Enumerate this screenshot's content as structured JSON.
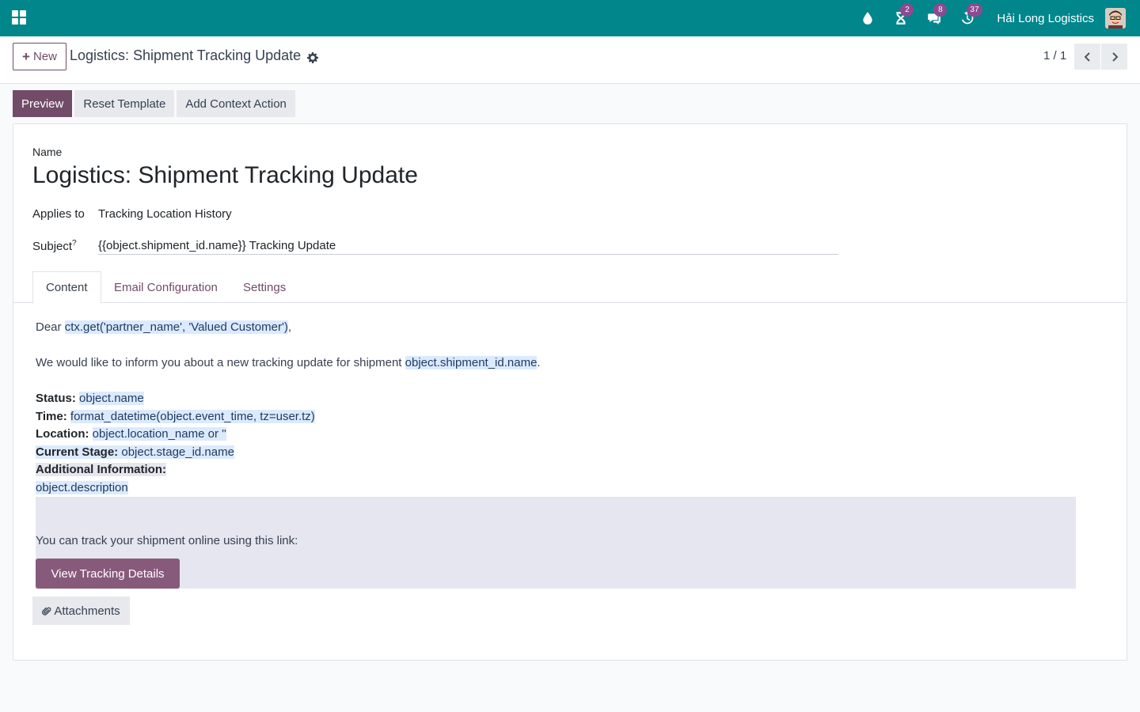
{
  "navbar": {
    "company": "Hải Long Logistics",
    "badges": {
      "activities": "2",
      "messages": "8",
      "updates": "37"
    }
  },
  "control_panel": {
    "new_label": "New",
    "title": "Logistics: Shipment Tracking Update",
    "pager": "1 / 1"
  },
  "header_buttons": {
    "preview": "Preview",
    "reset": "Reset Template",
    "context": "Add Context Action"
  },
  "form": {
    "name_label": "Name",
    "name_value": "Logistics: Shipment Tracking Update",
    "applies_label": "Applies to",
    "applies_value": "Tracking Location History",
    "subject_label": "Subject",
    "subject_help": "?",
    "subject_value": "{{object.shipment_id.name}} Tracking Update"
  },
  "tabs": {
    "content": "Content",
    "email_config": "Email Configuration",
    "settings": "Settings"
  },
  "body": {
    "dear": "Dear ",
    "partner_expr": "ctx.get('partner_name', 'Valued Customer')",
    "comma": ",",
    "inform": "We would like to inform you about a new tracking update for shipment ",
    "shipment_expr": "object.shipment_id.name",
    "period": ".",
    "status_label": "Status:",
    "status_expr": "object.name",
    "time_label": "Time:",
    "time_expr": "format_datetime(object.event_time, tz=user.tz)",
    "location_label": "Location:",
    "location_expr": "object.location_name or ''",
    "stage_label": "Current Stage:",
    "stage_expr": "object.stage_id.name",
    "additional_label": "Additional Information:",
    "description_expr": "object.description",
    "track_text": "You can track your shipment online using this link:",
    "track_button": "View Tracking Details",
    "attachments": "Attachments"
  }
}
